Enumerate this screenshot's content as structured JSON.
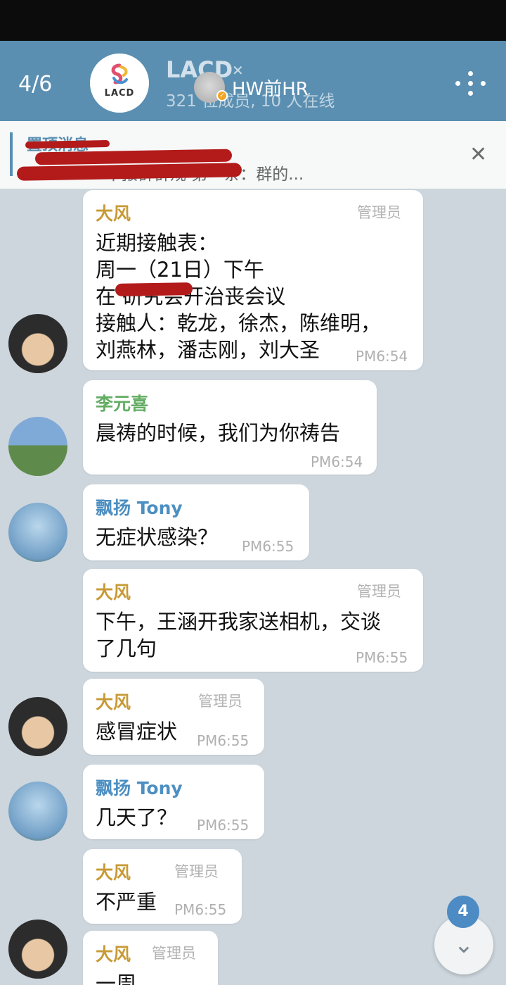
{
  "header": {
    "back_label": "4/6",
    "group_title": "LACD",
    "group_logo_text": "LACD",
    "group_subtitle": "321 位成员, 10 人在线",
    "watermark_name": "HW前HR",
    "mute_icon": "mute-icon"
  },
  "pinned": {
    "title": "置顶消息",
    "text": "中报群群规 第一条：群的..."
  },
  "messages": [
    {
      "sender": "大风",
      "role": "管理员",
      "text": "近期接触表：\n周一（21日）下午\n在 研究会开治丧会议\n接触人：乾龙，徐杰，陈维明，\n刘燕林，潘志刚，刘大圣",
      "time": "PM6:54"
    },
    {
      "sender": "李元喜",
      "role": "",
      "text": "晨祷的时候，我们为你祷告",
      "time": "PM6:54"
    },
    {
      "sender": "飘扬 Tony",
      "role": "",
      "text": "无症状感染？",
      "time": "PM6:55"
    },
    {
      "sender": "大风",
      "role": "管理员",
      "text": "下午，王涵开我家送相机，交谈\n了几句",
      "time": "PM6:55"
    },
    {
      "sender": "大风",
      "role": "管理员",
      "text": "感冒症状",
      "time": "PM6:55"
    },
    {
      "sender": "飘扬 Tony",
      "role": "",
      "text": "几天了？",
      "time": "PM6:55"
    },
    {
      "sender": "大风",
      "role": "管理员",
      "text": "不严重",
      "time": "PM6:55"
    },
    {
      "sender": "大风",
      "role": "管理员",
      "text": "一周",
      "time": ""
    }
  ],
  "scroll": {
    "unread_count": "4",
    "icon": "chevron-down-icon"
  },
  "colors": {
    "header": "#5a8fb1",
    "admin_name": "#c79a35",
    "member_green": "#63ad62",
    "member_blue": "#4c8fc2"
  }
}
